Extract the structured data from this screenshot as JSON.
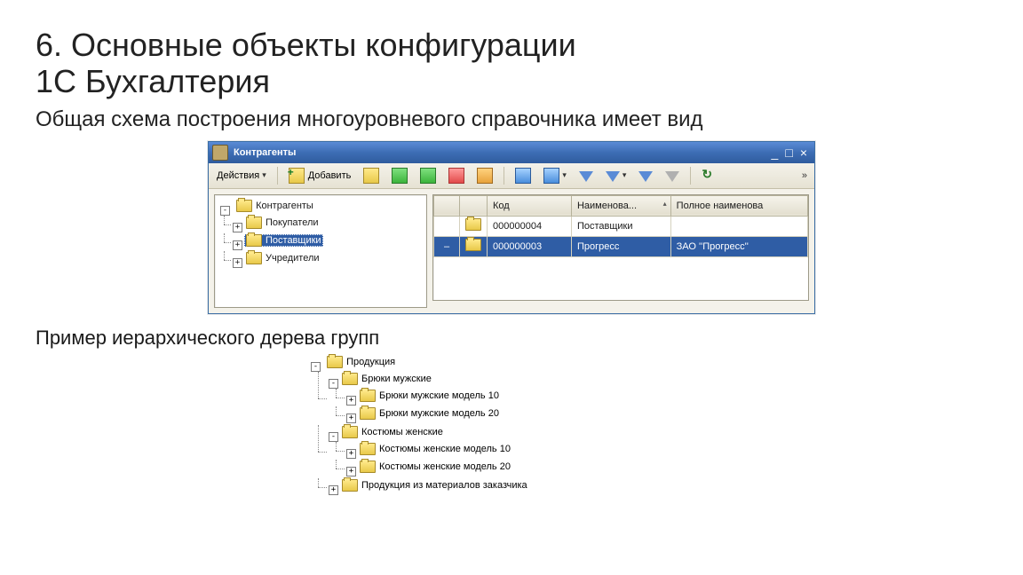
{
  "heading": {
    "line1": "6. Основные объекты конфигурации",
    "line2": "1С Бухгалтерия"
  },
  "subtitle": "Общая схема построения многоуровневого справочника имеет вид",
  "caption2": "Пример иерархического дерева групп",
  "window": {
    "title": "Контрагенты",
    "toolbar": {
      "actions_label": "Действия",
      "add_label": "Добавить"
    },
    "tree": {
      "root": "Контрагенты",
      "items": [
        "Покупатели",
        "Поставщики",
        "Учредители"
      ],
      "selected_index": 1
    },
    "table": {
      "columns": [
        "",
        "",
        "Код",
        "Наименова...",
        "Полное наименова"
      ],
      "rows": [
        {
          "mark": "",
          "code": "000000004",
          "name": "Поставщики",
          "full": ""
        },
        {
          "mark": "–",
          "code": "000000003",
          "name": "Прогресс",
          "full": "ЗАО ''Прогресс''"
        }
      ],
      "selected_row": 1
    }
  },
  "tree2": {
    "root": "Продукция",
    "children": [
      {
        "label": "Брюки мужские",
        "children": [
          {
            "label": "Брюки мужские  модель 10"
          },
          {
            "label": "Брюки мужские модель 20"
          }
        ]
      },
      {
        "label": "Костюмы женские",
        "children": [
          {
            "label": "Костюмы женские модель 10"
          },
          {
            "label": "Костюмы женские модель 20"
          }
        ]
      },
      {
        "label": "Продукция из материалов заказчика"
      }
    ]
  }
}
